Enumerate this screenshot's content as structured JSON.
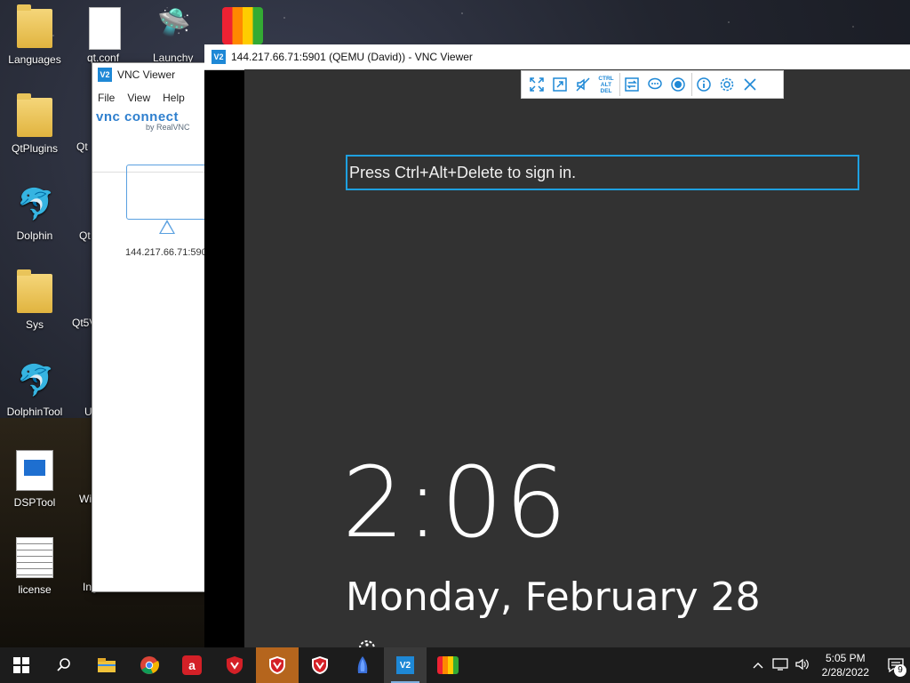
{
  "desktop": {
    "icons": [
      {
        "label": "Languages"
      },
      {
        "label": "QtPlugins"
      },
      {
        "label": "Dolphin"
      },
      {
        "label": "Sys"
      },
      {
        "label": "DolphinTool"
      },
      {
        "label": "DSPTool"
      },
      {
        "label": "license"
      }
    ],
    "partial_labels": [
      "qt.conf",
      "Launchy",
      "Qt",
      "Qt",
      "Qt5V",
      "U",
      "Wi",
      "Ing"
    ]
  },
  "address_book": {
    "title": "VNC Viewer",
    "menu": [
      "File",
      "View",
      "Help"
    ],
    "brand": "vnc connect",
    "brand_sub": "by RealVNC",
    "connection_label": "144.217.66.71:590"
  },
  "session": {
    "title": "144.217.66.71:5901 (QEMU (David)) - VNC Viewer",
    "toolbar": {
      "cad_text": "CTRL ALT DEL"
    },
    "signin_prompt": "Press Ctrl+Alt+Delete to sign in.",
    "clock": "2:06",
    "date": "Monday, February 28"
  },
  "taskbar": {
    "time": "5:05 PM",
    "date": "2/28/2022",
    "notification_count": "9"
  }
}
